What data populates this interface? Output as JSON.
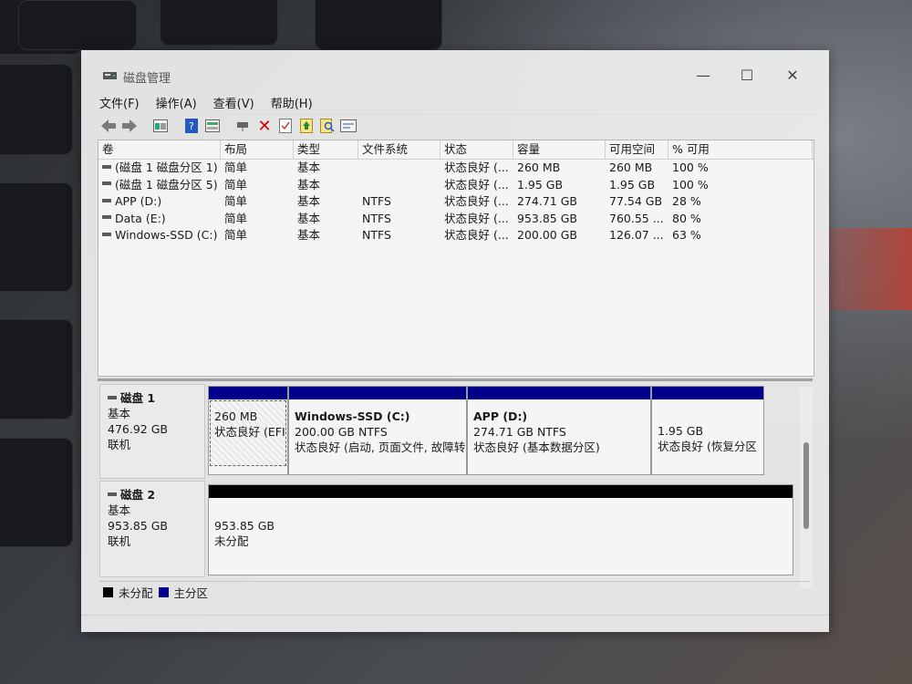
{
  "window": {
    "title": "磁盘管理"
  },
  "menu": [
    "文件(F)",
    "操作(A)",
    "查看(V)",
    "帮助(H)"
  ],
  "toolbar": [
    "back-icon",
    "forward-icon",
    "disk-list-icon",
    "help-icon",
    "properties-icon",
    "connect-icon",
    "delete-icon",
    "check-icon",
    "import-icon",
    "search-icon",
    "settings-icon"
  ],
  "volume_table": {
    "columns": [
      "卷",
      "布局",
      "类型",
      "文件系统",
      "状态",
      "容量",
      "可用空间",
      "% 可用"
    ],
    "rows": [
      [
        "(磁盘 1 磁盘分区 1)",
        "简单",
        "基本",
        "",
        "状态良好 (...",
        "260 MB",
        "260 MB",
        "100 %"
      ],
      [
        "(磁盘 1 磁盘分区 5)",
        "简单",
        "基本",
        "",
        "状态良好 (...",
        "1.95 GB",
        "1.95 GB",
        "100 %"
      ],
      [
        "APP (D:)",
        "简单",
        "基本",
        "NTFS",
        "状态良好 (...",
        "274.71 GB",
        "77.54 GB",
        "28 %"
      ],
      [
        "Data (E:)",
        "简单",
        "基本",
        "NTFS",
        "状态良好 (...",
        "953.85 GB",
        "760.55 ...",
        "80 %"
      ],
      [
        "Windows-SSD (C:)",
        "简单",
        "基本",
        "NTFS",
        "状态良好 (...",
        "200.00 GB",
        "126.07 ...",
        "63 %"
      ]
    ]
  },
  "disks": [
    {
      "name": "磁盘 1",
      "type": "基本",
      "size": "476.92 GB",
      "status": "联机",
      "partitions": [
        {
          "name": "",
          "size": "260 MB",
          "status": "状态良好 (EFI"
        },
        {
          "name": "Windows-SSD  (C:)",
          "size": "200.00 GB NTFS",
          "status": "状态良好 (启动, 页面文件, 故障转"
        },
        {
          "name": "APP  (D:)",
          "size": "274.71 GB NTFS",
          "status": "状态良好 (基本数据分区)"
        },
        {
          "name": "",
          "size": "1.95 GB",
          "status": "状态良好 (恢复分区"
        }
      ]
    },
    {
      "name": "磁盘 2",
      "type": "基本",
      "size": "953.85 GB",
      "status": "联机",
      "partitions": [
        {
          "name": "",
          "size": "953.85 GB",
          "status": "未分配"
        }
      ]
    }
  ],
  "legend": [
    {
      "label": "未分配",
      "color": "#000000"
    },
    {
      "label": "主分区",
      "color": "#00008b"
    }
  ],
  "colors": {
    "primary_partition": "#00008b",
    "unallocated": "#000000"
  }
}
